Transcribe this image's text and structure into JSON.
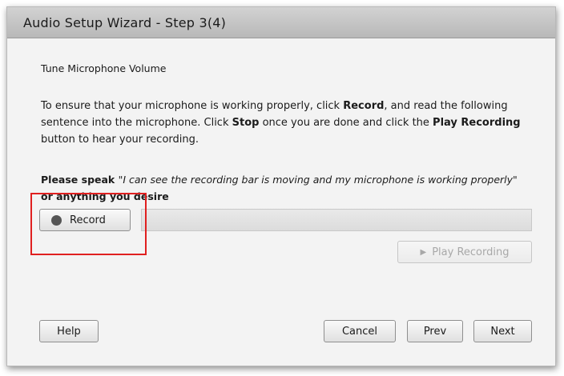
{
  "dialog": {
    "title": "Audio Setup Wizard - Step 3(4)",
    "section_title": "Tune Microphone Volume",
    "instructions": {
      "part1": "To ensure that your microphone is working properly, click ",
      "record_word": "Record",
      "part2": ", and read the following sentence into the microphone. Click ",
      "stop_word": "Stop",
      "part3": " once you are done and click the ",
      "play_word": "Play Recording",
      "part4": " button to hear your recording."
    },
    "prompt": {
      "lead": "Please speak ",
      "sentence": "\"I can see the recording bar is moving and my microphone is working properly\"",
      "tail": " or anything you desire"
    },
    "record_button": {
      "label": "Record",
      "icon": "record-dot-icon"
    },
    "level_meter": {
      "level": 0
    },
    "play_button": {
      "label": "Play Recording",
      "icon": "play-icon",
      "enabled": false
    },
    "footer": {
      "help_label": "Help",
      "cancel_label": "Cancel",
      "prev_label": "Prev",
      "next_label": "Next"
    }
  },
  "annotation": {
    "color": "#e02020"
  }
}
